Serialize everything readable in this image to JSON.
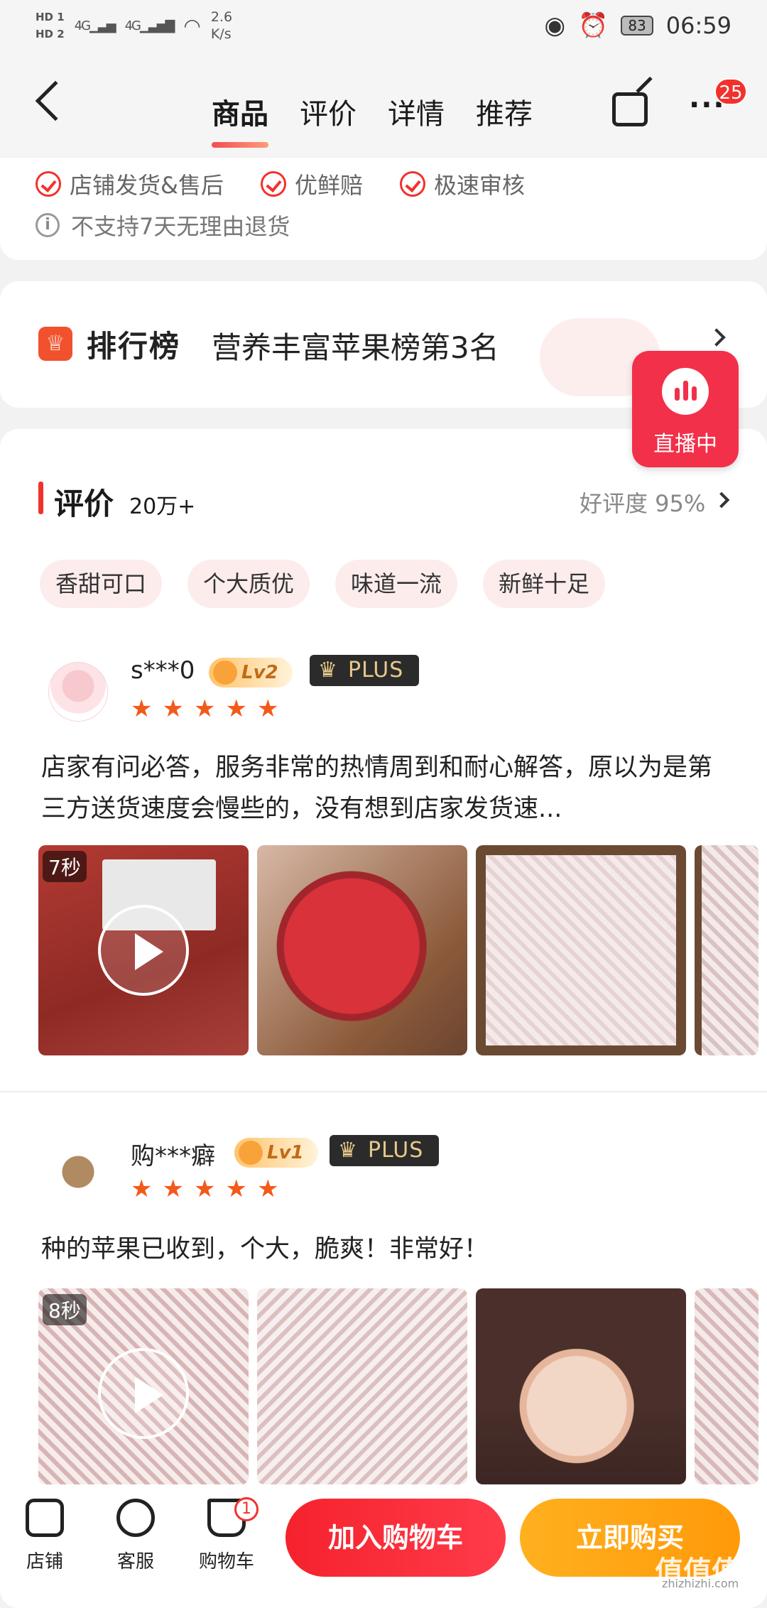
{
  "status_bar": {
    "hd1": "HD 1",
    "hd2": "HD 2",
    "net1": "4G",
    "net2": "4G",
    "speed_value": "2.6",
    "speed_unit": "K/s",
    "battery": "83",
    "time": "06:59"
  },
  "nav": {
    "tabs": [
      "商品",
      "评价",
      "详情",
      "推荐"
    ],
    "active_tab": 0,
    "more_badge": "25"
  },
  "service": {
    "items": [
      "店铺发货&售后",
      "优鲜赔",
      "极速审核"
    ],
    "notice": "不支持7天无理由退货"
  },
  "ranking": {
    "brand": "排行榜",
    "text": "营养丰富苹果榜第3名"
  },
  "live": {
    "label": "直播中"
  },
  "reviews": {
    "title": "评价",
    "count": "20万+",
    "rating": "好评度 95%",
    "tags": [
      "香甜可口",
      "个大质优",
      "味道一流",
      "新鲜十足"
    ],
    "items": [
      {
        "user": "s***0",
        "level": "Lv2",
        "plus": "PLUS",
        "stars": 5,
        "text": "店家有问必答，服务非常的热情周到和耐心解答，原以为是第三方送货速度会慢些的，没有想到店家发货速...",
        "video_time": "7秒"
      },
      {
        "user": "购***癖",
        "level": "Lv1",
        "plus": "PLUS",
        "stars": 5,
        "text": "种的苹果已收到，个大，脆爽！非常好！",
        "video_time": "8秒"
      }
    ]
  },
  "bottom": {
    "store": "店铺",
    "service": "客服",
    "cart": "购物车",
    "cart_badge": "1",
    "add_cart": "加入购物车",
    "buy_now": "立即购买"
  },
  "colors": {
    "accent": "#f2312d",
    "buy_orange": "#ffa010"
  },
  "watermark": {
    "logo": "值值值",
    "url": "zhizhizhi.com"
  }
}
